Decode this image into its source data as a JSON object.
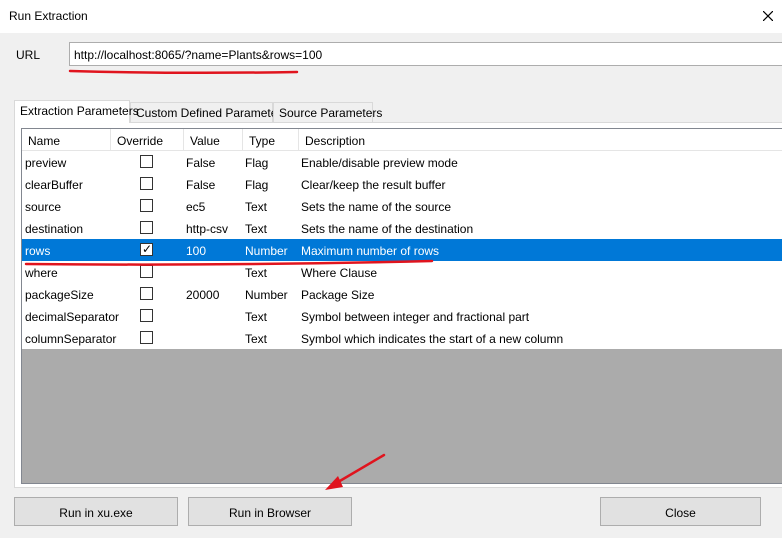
{
  "window": {
    "title": "Run Extraction"
  },
  "url": {
    "label": "URL",
    "value": "http://localhost:8065/?name=Plants&rows=100"
  },
  "tabs": [
    {
      "label": "Extraction Parameters",
      "active": true
    },
    {
      "label": "Custom Defined Parameters",
      "active": false
    },
    {
      "label": "Source Parameters",
      "active": false
    }
  ],
  "columns": {
    "name": "Name",
    "override": "Override",
    "value": "Value",
    "type": "Type",
    "description": "Description"
  },
  "rows": [
    {
      "name": "preview",
      "override": false,
      "value": "False",
      "type": "Flag",
      "description": "Enable/disable preview mode"
    },
    {
      "name": "clearBuffer",
      "override": false,
      "value": "False",
      "type": "Flag",
      "description": "Clear/keep the result buffer"
    },
    {
      "name": "source",
      "override": false,
      "value": "ec5",
      "type": "Text",
      "description": "Sets the name of the source"
    },
    {
      "name": "destination",
      "override": false,
      "value": "http-csv",
      "type": "Text",
      "description": "Sets the name of the destination"
    },
    {
      "name": "rows",
      "override": true,
      "value": "100",
      "type": "Number",
      "description": "Maximum number of rows",
      "selected": true
    },
    {
      "name": "where",
      "override": false,
      "value": "",
      "type": "Text",
      "description": "Where Clause"
    },
    {
      "name": "packageSize",
      "override": false,
      "value": "20000",
      "type": "Number",
      "description": "Package Size"
    },
    {
      "name": "decimalSeparator",
      "override": false,
      "value": "",
      "type": "Text",
      "description": "Symbol between integer and fractional part"
    },
    {
      "name": "columnSeparator",
      "override": false,
      "value": "",
      "type": "Text",
      "description": "Symbol which indicates the start of a new column"
    }
  ],
  "buttons": {
    "run_xu": "Run in xu.exe",
    "run_browser": "Run in Browser",
    "close": "Close"
  },
  "colors": {
    "selection": "#0078d7",
    "annotation": "#e0141e"
  },
  "icons": {
    "close": "close-icon"
  }
}
